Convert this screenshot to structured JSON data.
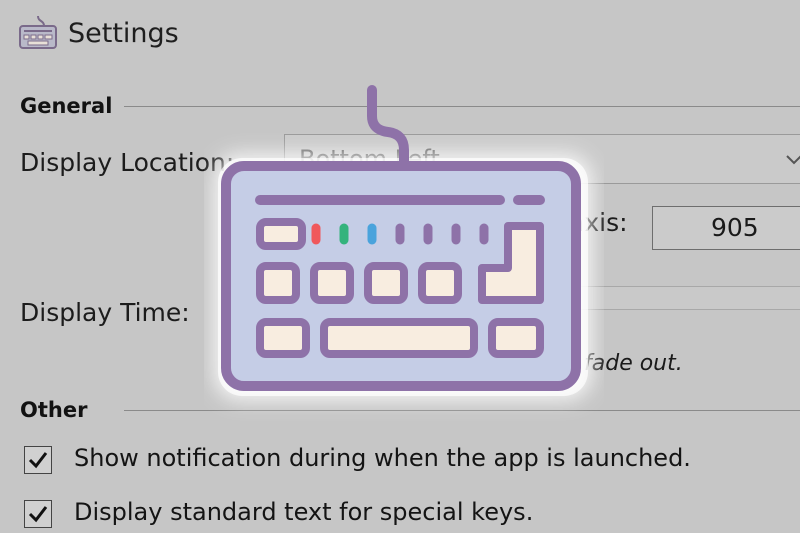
{
  "window": {
    "title": "Settings",
    "icon": "keyboard-icon"
  },
  "general": {
    "group_label": "General",
    "display_location_label": "Display Location:",
    "display_location_value": "Bottom Left",
    "axis_label": "-axis:",
    "axis_value": "905",
    "display_time_label": "Display Time:",
    "hint_text": "fade out."
  },
  "other": {
    "group_label": "Other",
    "options": [
      {
        "label": "Show notification during when the app is launched.",
        "checked": true
      },
      {
        "label": "Display standard text for special keys.",
        "checked": true
      }
    ]
  },
  "overlay": {
    "icon": "keyboard-icon",
    "colors": {
      "outline": "#8e72a8",
      "body": "#c5cde6",
      "keys": "#f8ede0",
      "led_red": "#f0585c",
      "led_green": "#34b37c",
      "led_blue": "#4aa3dc"
    }
  }
}
